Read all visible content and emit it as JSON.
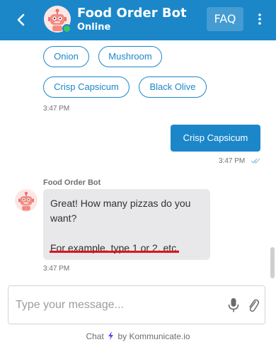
{
  "header": {
    "title": "Food Order Bot",
    "status": "Online",
    "faq_label": "FAQ"
  },
  "chat": {
    "quick_replies": [
      {
        "label": "Onion"
      },
      {
        "label": "Mushroom"
      },
      {
        "label": "Crisp Capsicum"
      },
      {
        "label": "Black Olive"
      }
    ],
    "qr_time": "3:47 PM",
    "sent": {
      "text": "Crisp Capsicum",
      "time": "3:47 PM"
    },
    "received": {
      "sender": "Food Order Bot",
      "line1": "Great! How many pizzas do you",
      "line2": "want?",
      "line3": "For example, type 1 or 2, etc.",
      "time": "3:47 PM"
    }
  },
  "composer": {
    "placeholder": "Type your message..."
  },
  "footer": {
    "prefix": "Chat",
    "suffix": "by Kommunicate.io"
  },
  "icons": {
    "back": "chevron-left-icon",
    "menu": "kebab-menu-icon",
    "mic": "microphone-icon",
    "attach": "paperclip-icon",
    "bolt": "lightning-icon",
    "tick": "double-check-icon"
  },
  "colors": {
    "brand": "#1b87c9",
    "online": "#3cc463",
    "bubble_received": "#e8e8ea",
    "highlight": "#e0131c",
    "bolt": "#5b49e6"
  }
}
